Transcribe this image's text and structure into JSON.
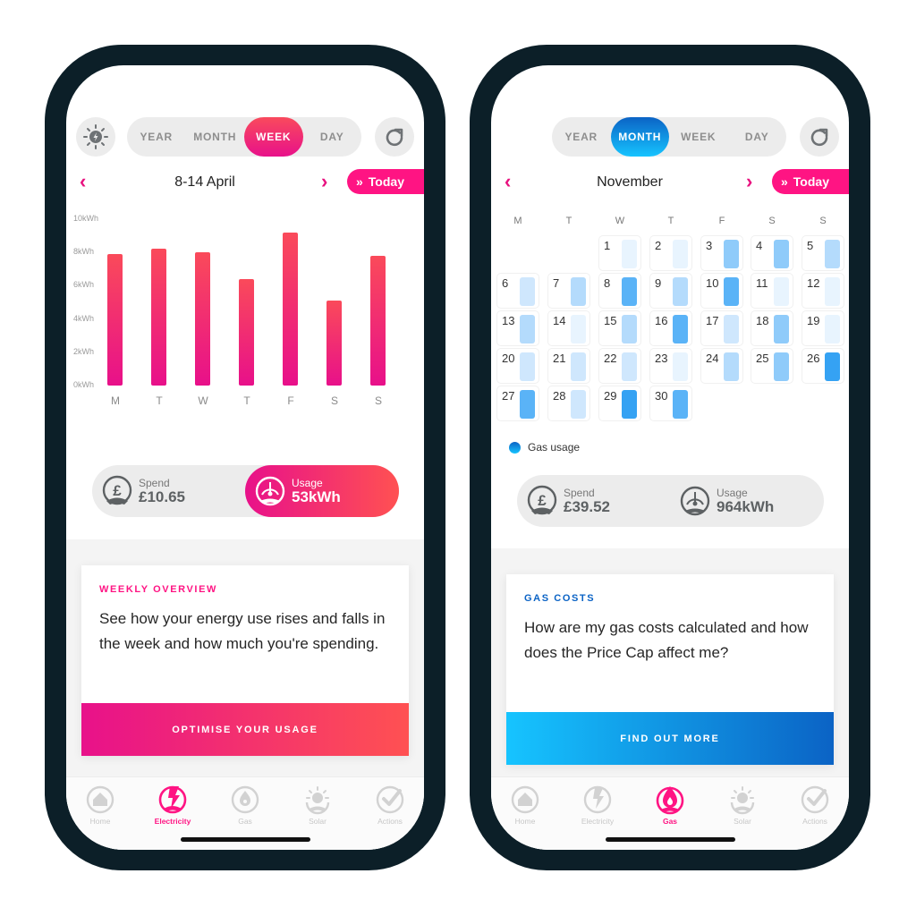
{
  "colors": {
    "brand_pink": "#ff1483",
    "electric_gradient": [
      "#e8118a",
      "#ff5152"
    ],
    "gas_gradient": [
      "#16c4ff",
      "#0b63c5"
    ],
    "frame": "#0c1f28",
    "heat_levels": [
      "#e8f4fe",
      "#cfe7fd",
      "#b4dbfc",
      "#8fcbfa",
      "#5ab3f7",
      "#35a2f3"
    ]
  },
  "electricity_screen": {
    "icons": {
      "left_button": "solar-sun-bolt-icon",
      "right_button": "refresh-icon"
    },
    "period_tabs": [
      "YEAR",
      "MONTH",
      "WEEK",
      "DAY"
    ],
    "active_period": "WEEK",
    "date_range": "8-14 April",
    "prev_icon": "chevron-left-icon",
    "next_icon": "chevron-right-icon",
    "today_label": "Today",
    "summary": {
      "spend_label": "Spend",
      "spend_value": "£10.65",
      "usage_label": "Usage",
      "usage_value": "53kWh",
      "active": "usage"
    },
    "card": {
      "kicker": "WEEKLY OVERVIEW",
      "body": "See how your energy use rises and falls in the week and how much you're spending.",
      "cta": "OPTIMISE YOUR USAGE"
    },
    "tabs": [
      {
        "label": "Home",
        "icon": "home-icon"
      },
      {
        "label": "Electricity",
        "icon": "lightning-icon"
      },
      {
        "label": "Gas",
        "icon": "flame-icon"
      },
      {
        "label": "Solar",
        "icon": "sun-icon"
      },
      {
        "label": "Actions",
        "icon": "checkmark-icon"
      }
    ],
    "active_tab": "Electricity"
  },
  "chart_data": {
    "type": "bar",
    "title": "",
    "xlabel": "",
    "ylabel": "",
    "categories": [
      "M",
      "T",
      "W",
      "T",
      "F",
      "S",
      "S"
    ],
    "values": [
      7.9,
      8.2,
      8.0,
      6.4,
      9.2,
      5.1,
      7.8
    ],
    "unit": "kWh",
    "ylim": [
      0,
      10
    ],
    "yticks": [
      0,
      2,
      4,
      6,
      8,
      10
    ],
    "ytick_labels": [
      "0kWh",
      "2kWh",
      "4kWh",
      "6kWh",
      "8kWh",
      "10kWh"
    ],
    "grid": false,
    "legend": "none"
  },
  "gas_screen": {
    "icons": {
      "right_button": "refresh-icon"
    },
    "period_tabs": [
      "YEAR",
      "MONTH",
      "WEEK",
      "DAY"
    ],
    "active_period": "MONTH",
    "month": "November",
    "prev_icon": "chevron-left-icon",
    "next_icon": "chevron-right-icon",
    "today_label": "Today",
    "weekdays": [
      "M",
      "T",
      "W",
      "T",
      "F",
      "S",
      "S"
    ],
    "first_weekday_index": 2,
    "days": [
      {
        "day": 1,
        "level": 0
      },
      {
        "day": 2,
        "level": 0
      },
      {
        "day": 3,
        "level": 3
      },
      {
        "day": 4,
        "level": 3
      },
      {
        "day": 5,
        "level": 2
      },
      {
        "day": 6,
        "level": 1
      },
      {
        "day": 7,
        "level": 2
      },
      {
        "day": 8,
        "level": 4
      },
      {
        "day": 9,
        "level": 2
      },
      {
        "day": 10,
        "level": 4
      },
      {
        "day": 11,
        "level": 0
      },
      {
        "day": 12,
        "level": 0
      },
      {
        "day": 13,
        "level": 2
      },
      {
        "day": 14,
        "level": 0
      },
      {
        "day": 15,
        "level": 2
      },
      {
        "day": 16,
        "level": 4
      },
      {
        "day": 17,
        "level": 1
      },
      {
        "day": 18,
        "level": 3
      },
      {
        "day": 19,
        "level": 0
      },
      {
        "day": 20,
        "level": 1
      },
      {
        "day": 21,
        "level": 1
      },
      {
        "day": 22,
        "level": 1
      },
      {
        "day": 23,
        "level": 0
      },
      {
        "day": 24,
        "level": 2
      },
      {
        "day": 25,
        "level": 3
      },
      {
        "day": 26,
        "level": 5
      },
      {
        "day": 27,
        "level": 4
      },
      {
        "day": 28,
        "level": 1
      },
      {
        "day": 29,
        "level": 5
      },
      {
        "day": 30,
        "level": 4
      }
    ],
    "legend_label": "Gas usage",
    "summary": {
      "spend_label": "Spend",
      "spend_value": "£39.52",
      "usage_label": "Usage",
      "usage_value": "964kWh"
    },
    "card": {
      "kicker": "GAS COSTS",
      "body": "How are my gas costs calculated and how does the Price Cap affect me?",
      "cta": "FIND OUT MORE"
    },
    "tabs": [
      {
        "label": "Home",
        "icon": "home-icon"
      },
      {
        "label": "Electricity",
        "icon": "lightning-icon"
      },
      {
        "label": "Gas",
        "icon": "flame-icon"
      },
      {
        "label": "Solar",
        "icon": "sun-icon"
      },
      {
        "label": "Actions",
        "icon": "checkmark-icon"
      }
    ],
    "active_tab": "Gas"
  }
}
